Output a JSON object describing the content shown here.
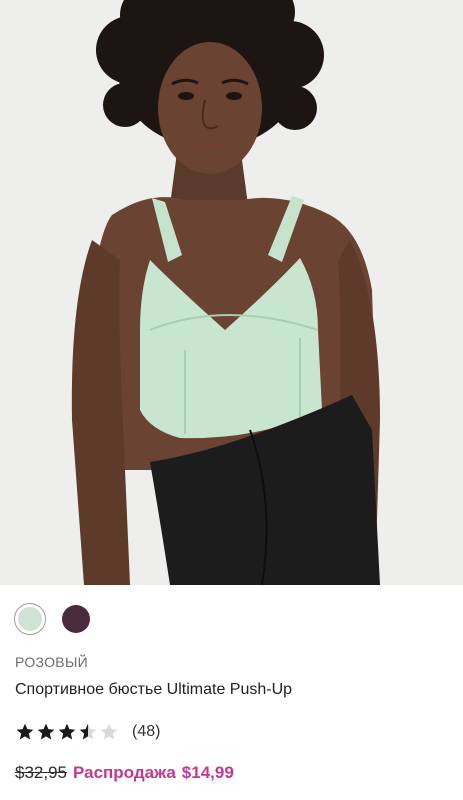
{
  "product": {
    "color_name": "РОЗОВЫЙ",
    "name": "Спортивное бюстье Ultimate Push-Up",
    "swatches": [
      {
        "name": "mint",
        "color": "#cfe3d5",
        "selected": true
      },
      {
        "name": "plum",
        "color": "#4a2a3d",
        "selected": false
      }
    ],
    "rating": {
      "value": 3.5,
      "max": 5,
      "count_text": "(48)"
    },
    "price": {
      "old": "$32,95",
      "sale_label": "Распродажа",
      "sale": "$14,99"
    }
  },
  "colors": {
    "sale": "#c8378f",
    "star_filled": "#1a1a1a",
    "star_empty": "#d9d9d9",
    "background": "#eeeeec"
  },
  "icons": {
    "star": "star-icon"
  }
}
